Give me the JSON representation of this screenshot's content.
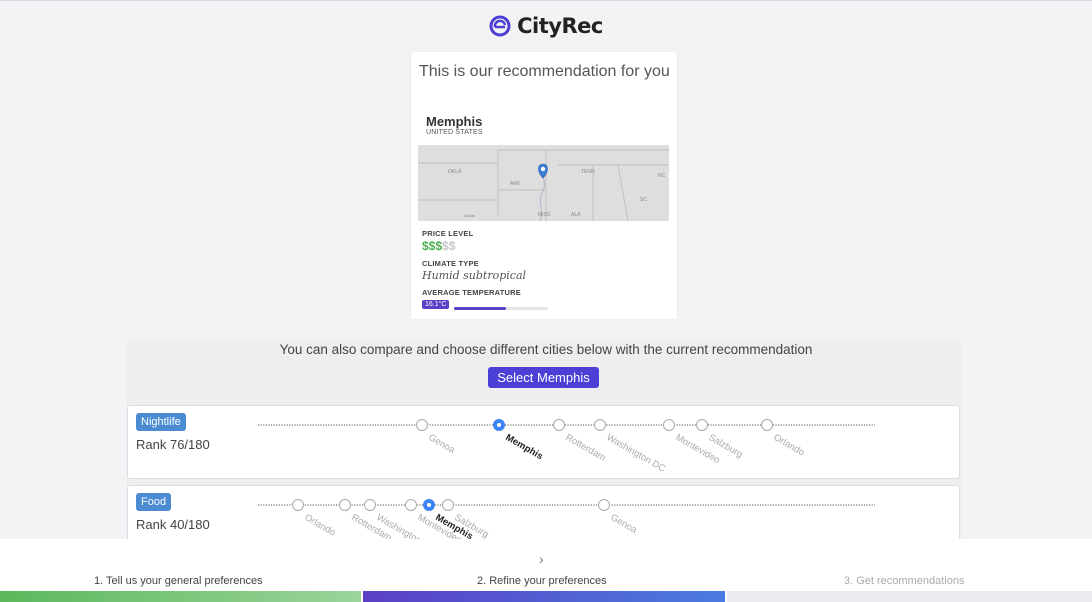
{
  "app": {
    "name": "CityRec"
  },
  "recommendation": {
    "title": "This is our recommendation for you",
    "city": "Memphis",
    "country": "UNITED STATES",
    "map_labels": [
      "OKLA",
      "ARK",
      "TENN",
      "MISS",
      "ALA",
      "Dallas",
      "NC",
      "SC"
    ],
    "price_label": "PRICE LEVEL",
    "price_level": 3,
    "price_max": 5,
    "price_on": "$$$",
    "price_off": "$$",
    "climate_label": "CLIMATE TYPE",
    "climate": "Humid subtropical",
    "temp_label": "AVERAGE TEMPERATURE",
    "temperature": "16.1°C",
    "temp_fraction": 0.55
  },
  "compare": {
    "text": "You can also compare and choose different cities below with the current recommendation",
    "select_button": "Select Memphis"
  },
  "categories": [
    {
      "name": "Nightlife",
      "rank": "Rank 76/180",
      "cities": [
        "Genoa",
        "Memphis",
        "Rotterdam",
        "Washington DC",
        "Montevideo",
        "Salzburg",
        "Orlando"
      ],
      "selected": "Memphis"
    },
    {
      "name": "Food",
      "rank": "Rank 40/180",
      "cities": [
        "Orlando",
        "Rotterdam",
        "Washington DC",
        "Montevideo",
        "Memphis",
        "Salzburg",
        "Genoa"
      ],
      "selected": "Memphis"
    }
  ],
  "footer": {
    "steps": [
      "1. Tell us your general preferences",
      "2. Refine your preferences",
      "3. Get recommendations"
    ],
    "chevron": "›"
  },
  "colors": {
    "accent": "#4b3fd6",
    "badge": "#4a8bd2",
    "price_on": "#4caf50",
    "temp": "#5b3fc4",
    "selected_marker": "#3b82f6"
  }
}
